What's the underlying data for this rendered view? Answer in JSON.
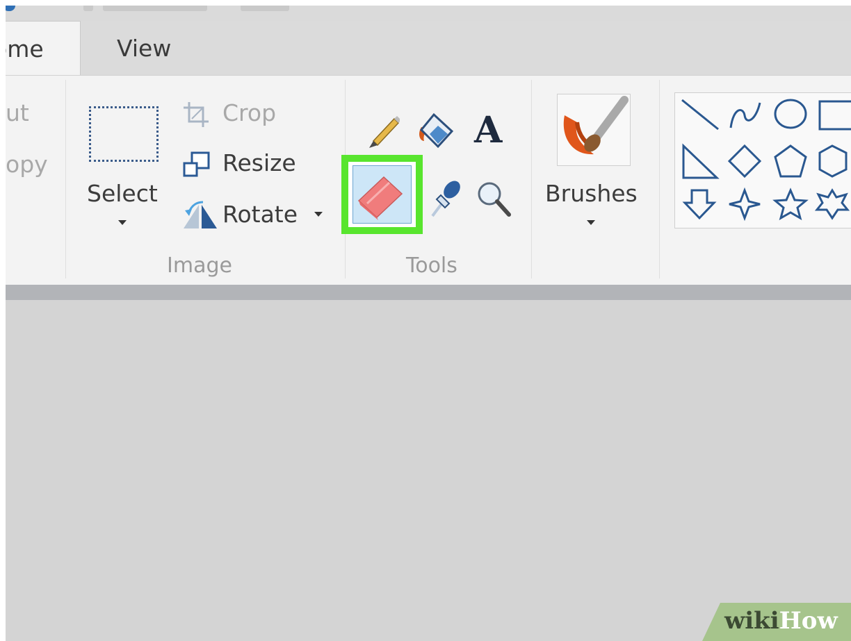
{
  "tabs": {
    "home": "ome",
    "view": "View"
  },
  "clipboard": {
    "cut_label": "ut",
    "copy_label": "opy"
  },
  "image_group": {
    "select_label": "Select",
    "crop_label": "Crop",
    "resize_label": "Resize",
    "rotate_label": "Rotate",
    "group_label": "Image"
  },
  "tools_group": {
    "text_tool_glyph": "A",
    "group_label": "Tools",
    "selected_tool": "eraser",
    "highlight_color": "#58e52e"
  },
  "brushes": {
    "label": "Brushes"
  },
  "icons": {
    "pencil": "pencil-icon",
    "fill": "fill-bucket-icon",
    "text": "text-icon",
    "eraser": "eraser-icon",
    "picker": "color-picker-icon",
    "magnifier": "magnifier-icon",
    "select": "select-rectangle-icon",
    "crop": "crop-icon",
    "resize": "resize-icon",
    "rotate": "rotate-icon",
    "brush": "brush-icon"
  },
  "watermark": {
    "part1": "wiki",
    "part2": "How",
    "color": "#a6c48c"
  }
}
